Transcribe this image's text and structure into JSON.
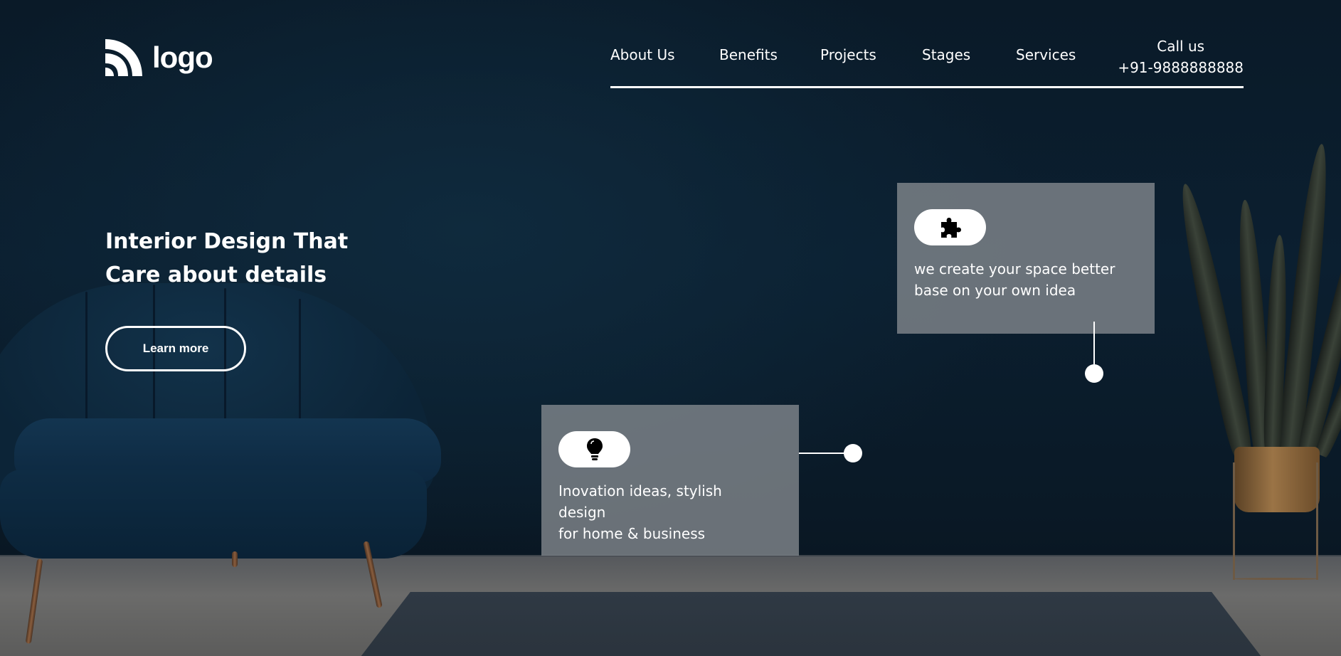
{
  "header": {
    "logo_text": "logo",
    "nav": [
      {
        "label": "About Us"
      },
      {
        "label": "Benefits"
      },
      {
        "label": "Projects"
      },
      {
        "label": "Stages"
      },
      {
        "label": "Services"
      }
    ],
    "call_label": "Call us",
    "phone": "+91-9888888888"
  },
  "hero": {
    "title_line1": "Interior Design That",
    "title_line2": "Care about details",
    "cta_label": "Learn more"
  },
  "cards": [
    {
      "icon": "puzzle-icon",
      "line1": "we create your space better",
      "line2": "base on your own idea"
    },
    {
      "icon": "lightbulb-icon",
      "line1": "Inovation ideas, stylish",
      "line2": "design",
      "line3": "for home & business"
    }
  ],
  "colors": {
    "background": "#0b1f30",
    "card": "#858a8f",
    "accent": "#ffffff"
  }
}
